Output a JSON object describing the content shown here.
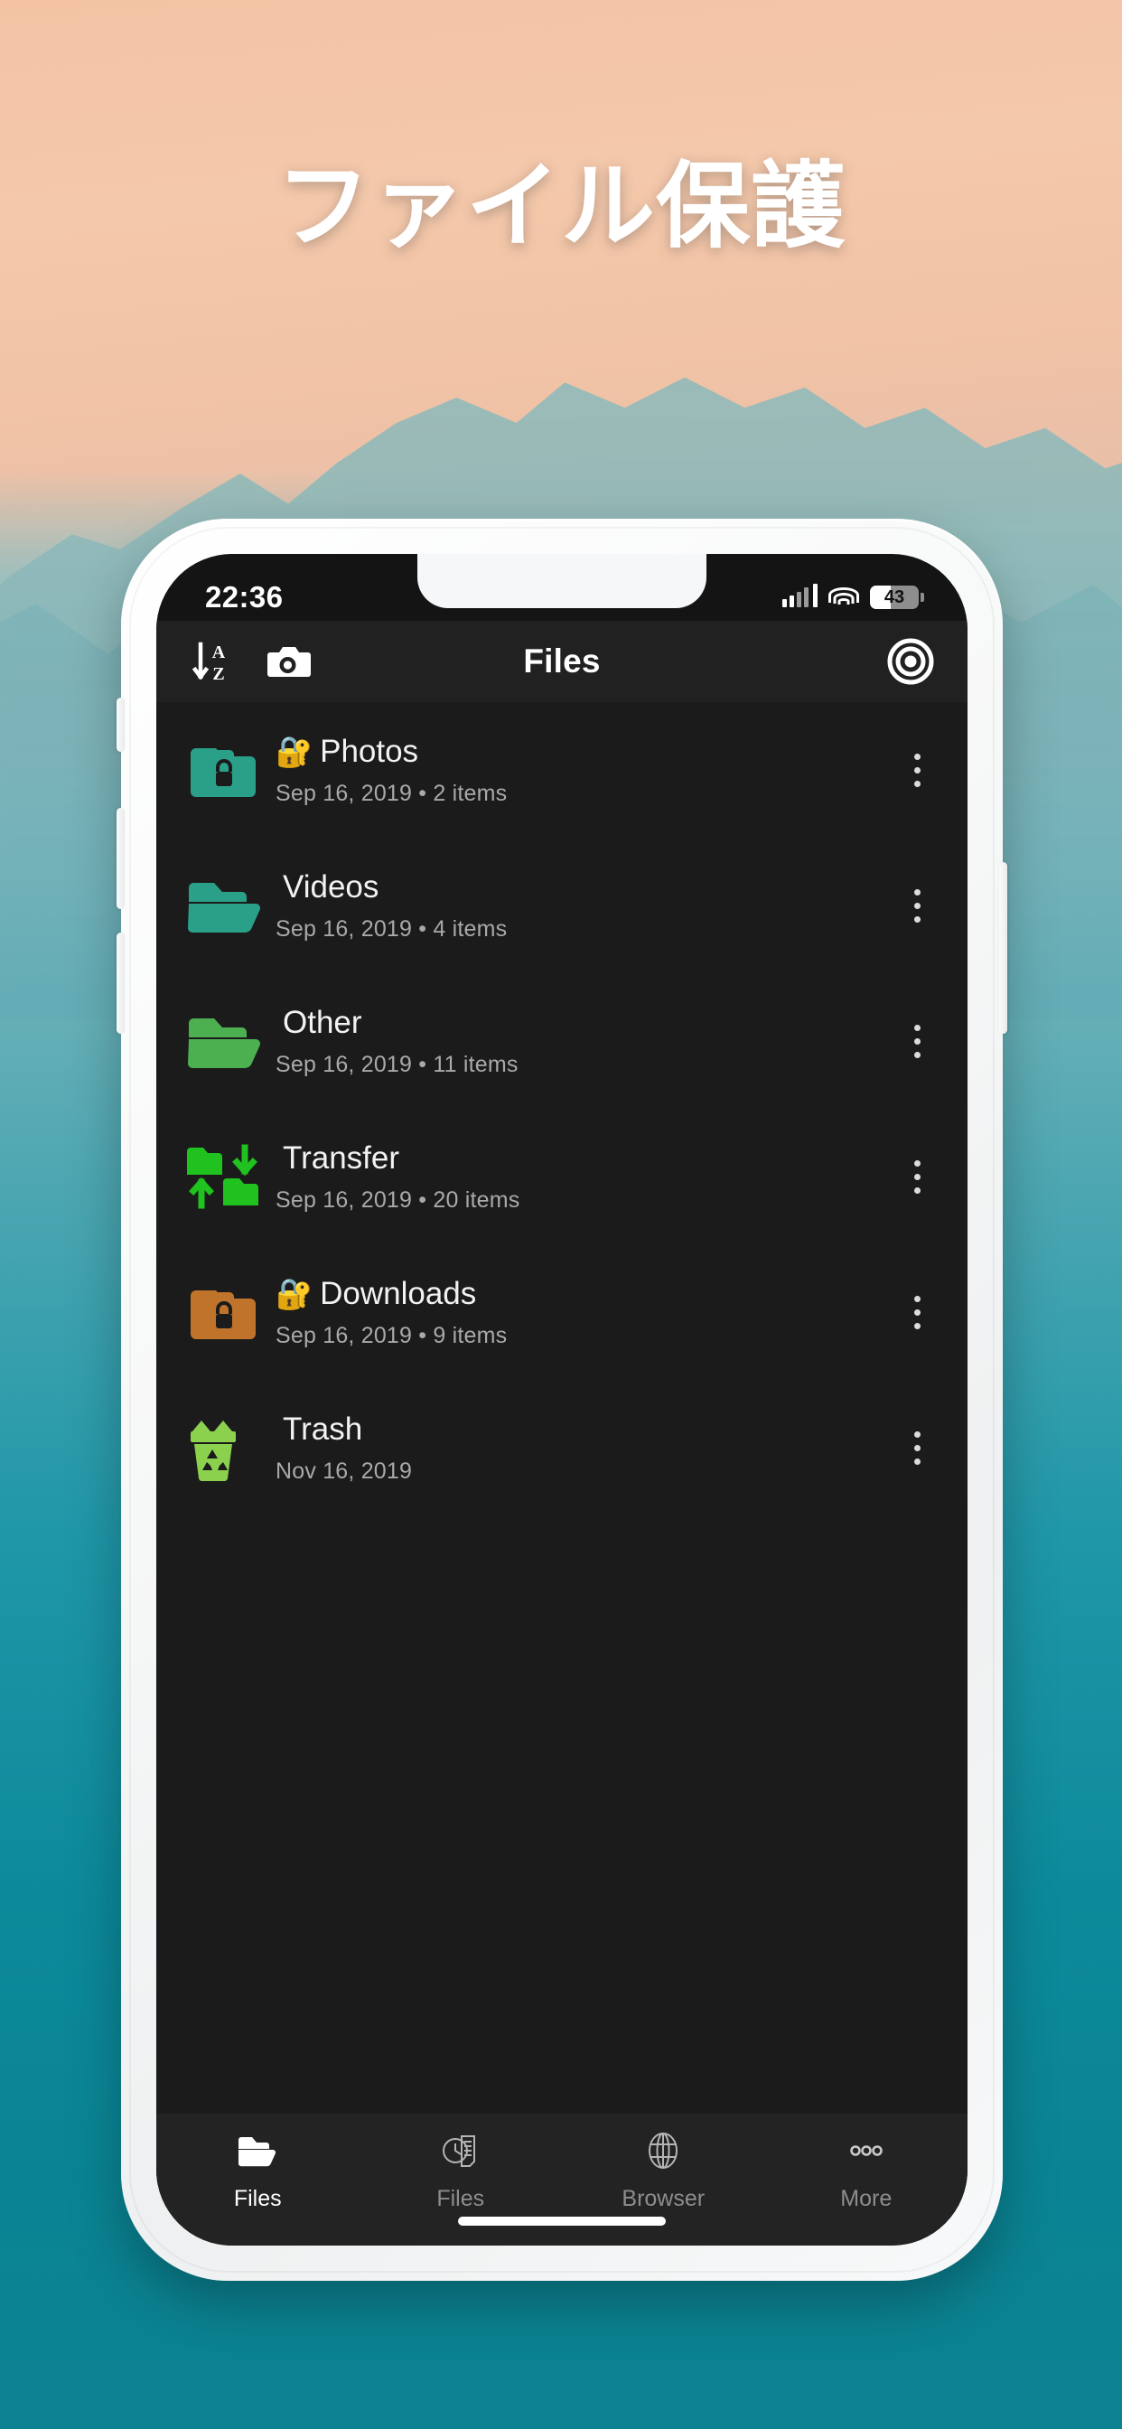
{
  "headline": "ファイル保護",
  "theme": {
    "sky_top": "#f3c3a4",
    "sea_bottom": "#0c8290",
    "screen_bg": "#1b1b1b",
    "header_bg": "#212121",
    "tabbar_bg": "#232323",
    "accent_teal": "#2aa088",
    "accent_green": "#4caf50",
    "accent_bright_green": "#1fc21f",
    "accent_orange": "#c0732a",
    "accent_trash_green": "#8bd14e"
  },
  "status_bar": {
    "time": "22:36",
    "signal_icon": "cellular-signal-icon",
    "wifi_icon": "wifi-icon",
    "battery_level": "43",
    "battery_icon": "battery-icon"
  },
  "app_header": {
    "title": "Files",
    "sort_icon": "sort-a-z-icon",
    "camera_icon": "camera-icon",
    "record_icon": "record-target-icon"
  },
  "files": [
    {
      "name": "Photos",
      "locked": true,
      "lock_emoji": "🔐",
      "date": "Sep 16, 2019",
      "count": "2 items",
      "subtitle": "Sep 16, 2019 • 2 items",
      "icon": "folder-locked-icon",
      "color": "#2aa088"
    },
    {
      "name": "Videos",
      "locked": false,
      "lock_emoji": "",
      "date": "Sep 16, 2019",
      "count": "4 items",
      "subtitle": "Sep 16, 2019 • 4 items",
      "icon": "folder-open-icon",
      "color": "#2aa088"
    },
    {
      "name": "Other",
      "locked": false,
      "lock_emoji": "",
      "date": "Sep 16, 2019",
      "count": "11 items",
      "subtitle": "Sep 16, 2019 • 11 items",
      "icon": "folder-open-icon",
      "color": "#4caf50"
    },
    {
      "name": "Transfer",
      "locked": false,
      "lock_emoji": "",
      "date": "Sep 16, 2019",
      "count": "20 items",
      "subtitle": "Sep 16, 2019 • 20 items",
      "icon": "folder-transfer-icon",
      "color": "#1fc21f"
    },
    {
      "name": "Downloads",
      "locked": true,
      "lock_emoji": "🔐",
      "date": "Sep 16, 2019",
      "count": "9 items",
      "subtitle": "Sep 16, 2019 • 9 items",
      "icon": "folder-locked-icon",
      "color": "#c0732a"
    },
    {
      "name": "Trash",
      "locked": false,
      "lock_emoji": "",
      "date": "Nov 16, 2019",
      "count": "",
      "subtitle": "Nov 16, 2019",
      "icon": "trash-recycle-icon",
      "color": "#8bd14e"
    }
  ],
  "row_menu_icon": "kebab-menu-icon",
  "tabs": [
    {
      "label": "Files",
      "icon": "folder-icon",
      "active": true
    },
    {
      "label": "Files",
      "icon": "recent-files-icon",
      "active": false
    },
    {
      "label": "Browser",
      "icon": "globe-icon",
      "active": false
    },
    {
      "label": "More",
      "icon": "more-dots-icon",
      "active": false
    }
  ]
}
